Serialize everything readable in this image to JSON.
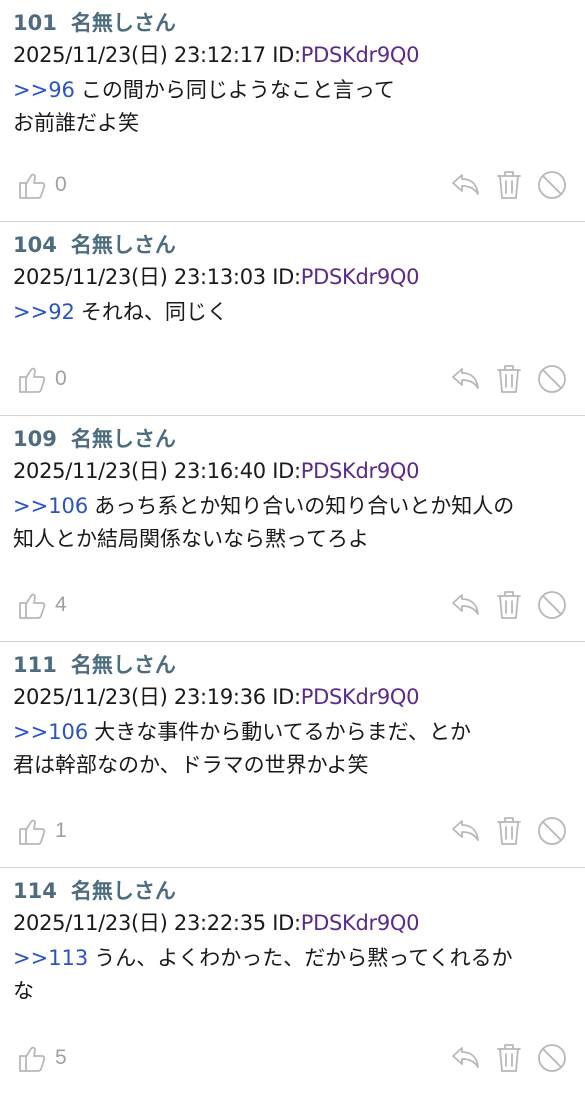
{
  "colors": {
    "header": "#4d6c80",
    "id": "#5c2a8a",
    "anchor": "#2a53c9",
    "icon": "#b8b8b8",
    "divider": "#d4d4d4"
  },
  "posts": [
    {
      "number": "101",
      "name": "名無しさん",
      "date": "2025/11/23(日) 23:12:17",
      "id_label": "ID:",
      "id": "PDSKdr9Q0",
      "anchor": ">>96",
      "lines": [
        "この間から同じようなこと言って",
        "お前誰だよ笑"
      ],
      "likes": "0"
    },
    {
      "number": "104",
      "name": "名無しさん",
      "date": "2025/11/23(日) 23:13:03",
      "id_label": "ID:",
      "id": "PDSKdr9Q0",
      "anchor": ">>92",
      "lines": [
        "それね、同じく"
      ],
      "likes": "0"
    },
    {
      "number": "109",
      "name": "名無しさん",
      "date": "2025/11/23(日) 23:16:40",
      "id_label": "ID:",
      "id": "PDSKdr9Q0",
      "anchor": ">>106",
      "lines": [
        "あっち系とか知り合いの知り合いとか知人の",
        "知人とか結局関係ないなら黙ってろよ"
      ],
      "likes": "4"
    },
    {
      "number": "111",
      "name": "名無しさん",
      "date": "2025/11/23(日) 23:19:36",
      "id_label": "ID:",
      "id": "PDSKdr9Q0",
      "anchor": ">>106",
      "lines": [
        "大きな事件から動いてるからまだ、とか",
        "君は幹部なのか、ドラマの世界かよ笑"
      ],
      "likes": "1"
    },
    {
      "number": "114",
      "name": "名無しさん",
      "date": "2025/11/23(日) 23:22:35",
      "id_label": "ID:",
      "id": "PDSKdr9Q0",
      "anchor": ">>113",
      "lines": [
        "うん、よくわかった、だから黙ってくれるか",
        "な"
      ],
      "likes": "5"
    }
  ]
}
